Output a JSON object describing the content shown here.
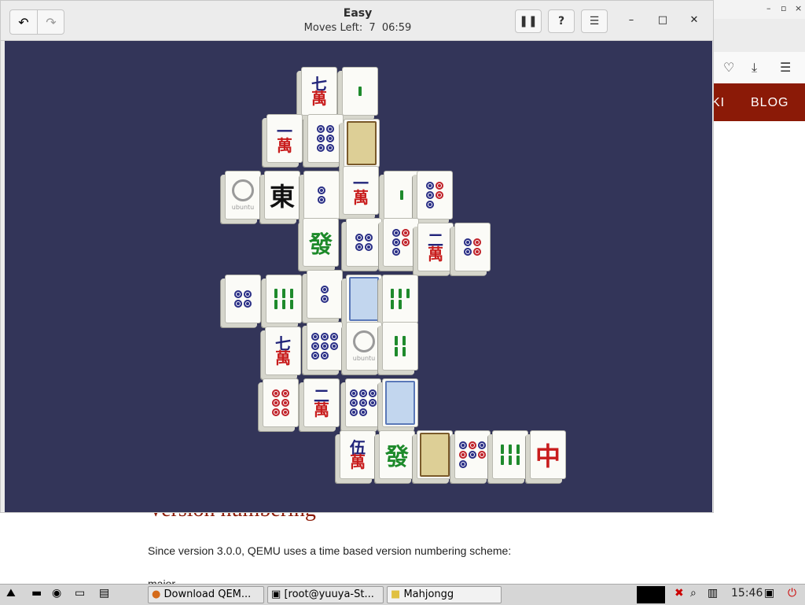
{
  "background_page": {
    "nav_items": [
      "KI",
      "BLOG"
    ],
    "heading": "Version numbering",
    "paragraph": "Since version 3.0.0, QEMU uses a time based version numbering scheme:",
    "cutoff_text": "major"
  },
  "window": {
    "title": "Easy",
    "moves_label": "Moves Left:",
    "moves_value": "7",
    "timer": "06:59"
  },
  "header_icons": {
    "undo": "undo-icon",
    "redo": "redo-icon",
    "pause": "pause-icon",
    "hint": "hint-icon",
    "menu": "menu-icon",
    "minimize": "minimize-icon",
    "maximize": "maximize-icon",
    "close": "close-icon"
  },
  "board": {
    "background": "#333559",
    "tiles": [
      {
        "type": "character",
        "top": "七",
        "bottom": "萬"
      },
      {
        "type": "bamboo",
        "count": 1
      },
      {
        "type": "character",
        "top": "一",
        "bottom": "萬"
      },
      {
        "type": "dots",
        "count": 6,
        "colors": "blue"
      },
      {
        "type": "flower"
      },
      {
        "type": "ubuntu",
        "label": "ubuntu"
      },
      {
        "type": "wind",
        "glyph": "東"
      },
      {
        "type": "dots",
        "count": 2,
        "colors": "blue"
      },
      {
        "type": "character",
        "top": "一",
        "bottom": "萬"
      },
      {
        "type": "bamboo",
        "count": 1
      },
      {
        "type": "dots",
        "count": 5,
        "colors": "mixed"
      },
      {
        "type": "dragon",
        "glyph": "發"
      },
      {
        "type": "dots",
        "count": 4,
        "colors": "blue"
      },
      {
        "type": "dots",
        "count": 5,
        "colors": "mixed"
      },
      {
        "type": "character",
        "top": "二",
        "bottom": "萬"
      },
      {
        "type": "dots",
        "count": 4,
        "colors": "mixed"
      },
      {
        "type": "dots",
        "count": 4,
        "colors": "blue"
      },
      {
        "type": "bamboo",
        "count": 6
      },
      {
        "type": "dots",
        "count": 2,
        "colors": "blue"
      },
      {
        "type": "season"
      },
      {
        "type": "bamboo",
        "count": 5
      },
      {
        "type": "character",
        "top": "七",
        "bottom": "萬"
      },
      {
        "type": "dots",
        "count": 8,
        "colors": "blue"
      },
      {
        "type": "ubuntu",
        "label": "ubuntu"
      },
      {
        "type": "bamboo",
        "count": 4
      },
      {
        "type": "dots",
        "count": 6,
        "colors": "red"
      },
      {
        "type": "character",
        "top": "二",
        "bottom": "萬"
      },
      {
        "type": "dots",
        "count": 8,
        "colors": "blue"
      },
      {
        "type": "season"
      },
      {
        "type": "character",
        "top": "伍",
        "bottom": "萬"
      },
      {
        "type": "dragon",
        "glyph": "發"
      },
      {
        "type": "flower"
      },
      {
        "type": "dots",
        "count": 7,
        "colors": "mixed"
      },
      {
        "type": "bamboo",
        "count": 6
      },
      {
        "type": "dragon-red",
        "glyph": "中"
      }
    ]
  },
  "taskbar": {
    "tasks": [
      {
        "label": "Download QEM...",
        "icon": "firefox-icon"
      },
      {
        "label": "[root@yuuya-St...",
        "icon": "terminal-icon"
      },
      {
        "label": "Mahjongg",
        "icon": "folder-icon"
      }
    ],
    "clock": "15:46"
  }
}
